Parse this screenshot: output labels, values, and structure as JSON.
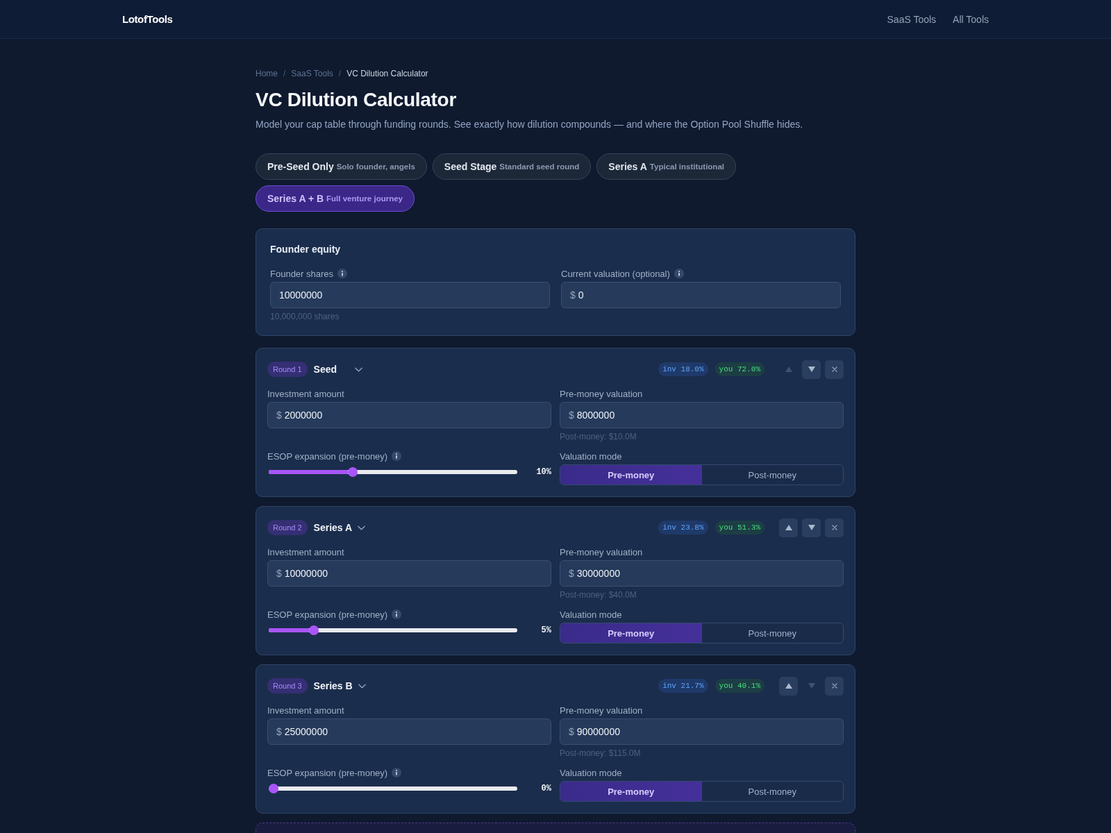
{
  "header": {
    "logo": "LotofTools",
    "links": [
      {
        "label": "SaaS Tools"
      },
      {
        "label": "All Tools"
      }
    ]
  },
  "breadcrumb": [
    {
      "label": "Home",
      "current": false
    },
    {
      "label": "SaaS Tools",
      "current": false,
      "separator": "/"
    },
    {
      "label": "VC Dilution Calculator",
      "current": true,
      "separator": "/"
    }
  ],
  "title": "VC Dilution Calculator",
  "subtitle": "Model your cap table through funding rounds. See exactly how dilution compounds — and where the Option Pool Shuffle hides.",
  "presets": [
    {
      "name": "Pre-Seed Only",
      "description": "Solo founder, angels",
      "selected": false
    },
    {
      "name": "Seed Stage",
      "description": "Standard seed round",
      "selected": false
    },
    {
      "name": "Series A",
      "description": "Typical institutional",
      "selected": false
    },
    {
      "name": "Series A + B",
      "description": "Full venture journey",
      "selected": true
    }
  ],
  "founder_equity": {
    "heading": "Founder equity",
    "fields": [
      {
        "label": "Founder shares",
        "info": true,
        "value": "10000000",
        "hint": "10,000,000 shares"
      },
      {
        "label": "Current valuation (optional)",
        "info": true,
        "prefix": "$",
        "value": "0"
      }
    ]
  },
  "rounds": [
    {
      "tag": "Round 1",
      "stage": "Seed",
      "investor_share": "inv 18.0%",
      "founder_share": "you 72.0%",
      "move_up_disabled": true,
      "move_down_disabled": false,
      "fields": [
        {
          "label": "Investment amount",
          "prefix": "$",
          "value": "2000000"
        },
        {
          "label": "Pre-money valuation",
          "prefix": "$",
          "value": "8000000",
          "hint": "Post-money: $10.0M"
        }
      ],
      "esop": {
        "label": "ESOP expansion (pre-money)",
        "info": true,
        "level": 0.33,
        "reading": "10%"
      },
      "valuation_mode": {
        "label": "Valuation mode",
        "options": [
          {
            "label": "Pre-money",
            "selected": true
          },
          {
            "label": "Post-money",
            "selected": false
          }
        ]
      }
    },
    {
      "tag": "Round 2",
      "stage": "Series A",
      "investor_share": "inv 23.8%",
      "founder_share": "you 51.3%",
      "move_up_disabled": false,
      "move_down_disabled": false,
      "fields": [
        {
          "label": "Investment amount",
          "prefix": "$",
          "value": "10000000"
        },
        {
          "label": "Pre-money valuation",
          "prefix": "$",
          "value": "30000000",
          "hint": "Post-money: $40.0M"
        }
      ],
      "esop": {
        "label": "ESOP expansion (pre-money)",
        "info": true,
        "level": 0.17,
        "reading": "5%"
      },
      "valuation_mode": {
        "label": "Valuation mode",
        "options": [
          {
            "label": "Pre-money",
            "selected": true
          },
          {
            "label": "Post-money",
            "selected": false
          }
        ]
      }
    },
    {
      "tag": "Round 3",
      "stage": "Series B",
      "investor_share": "inv 21.7%",
      "founder_share": "you 40.1%",
      "move_up_disabled": false,
      "move_down_disabled": true,
      "fields": [
        {
          "label": "Investment amount",
          "prefix": "$",
          "value": "25000000"
        },
        {
          "label": "Pre-money valuation",
          "prefix": "$",
          "value": "90000000",
          "hint": "Post-money: $115.0M"
        }
      ],
      "esop": {
        "label": "ESOP expansion (pre-money)",
        "info": true,
        "level": 0,
        "reading": "0%"
      },
      "valuation_mode": {
        "label": "Valuation mode",
        "options": [
          {
            "label": "Pre-money",
            "selected": true
          },
          {
            "label": "Post-money",
            "selected": false
          }
        ]
      }
    }
  ]
}
